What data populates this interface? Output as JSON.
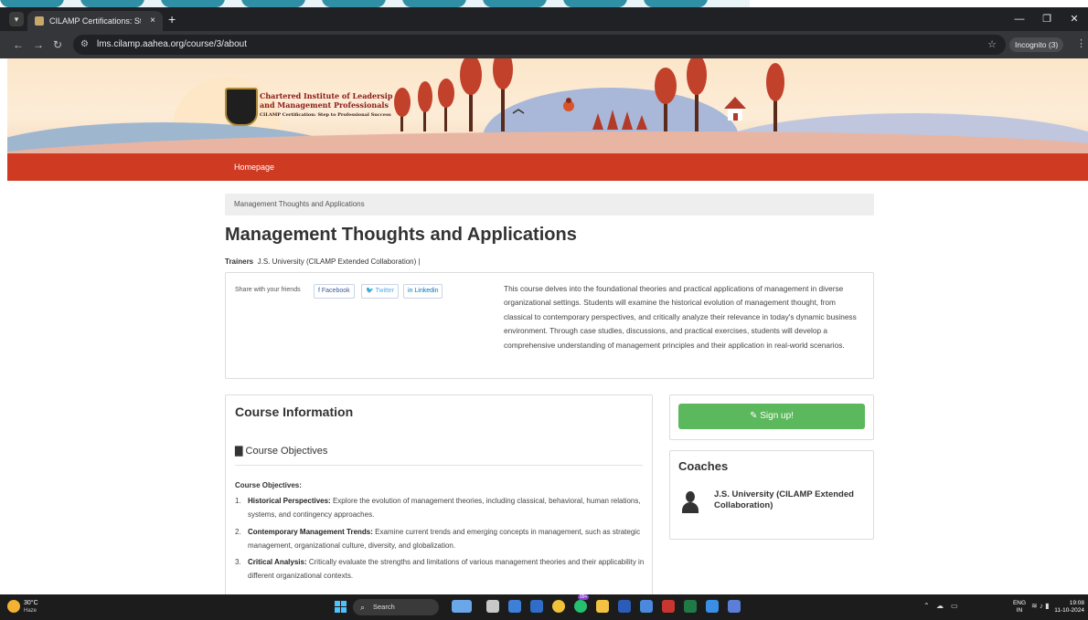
{
  "browser": {
    "tab_title": "CILAMP Certifications: Step to P",
    "tab_close": "×",
    "new_tab": "+",
    "url": "lms.cilamp.aahea.org/course/3/about",
    "incognito_label": "Incognito (3)",
    "window_controls": [
      "—",
      "❐",
      "✕"
    ],
    "nav": {
      "back": "←",
      "forward": "→",
      "reload": "↻"
    }
  },
  "banner": {
    "org_line1": "Chartered Institute of Leadersip",
    "org_line2": "and Management Professionals",
    "tagline": "CILAMP Certification: Step to Professional Success"
  },
  "nav": {
    "home": "Homepage"
  },
  "breadcrumb": "Management Thoughts and Applications",
  "course": {
    "title": "Management Thoughts and Applications",
    "trainers_label": "Trainers",
    "trainers_value": "J.S. University (CILAMP Extended Collaboration) |",
    "share_label": "Share with your friends",
    "share_buttons": [
      {
        "label": "f Facebook",
        "color": "#3b5998"
      },
      {
        "label": "🐦 Twitter",
        "color": "#55acee"
      },
      {
        "label": "in Linkedin",
        "color": "#0077b5"
      }
    ],
    "description": "This course delves into the foundational theories and practical applications of management in diverse organizational settings. Students will examine the historical evolution of management thought, from classical to contemporary perspectives, and critically analyze their relevance in today's dynamic business environment. Through case studies, discussions, and practical exercises, students will develop a comprehensive understanding of management principles and their application in real-world scenarios."
  },
  "course_info": {
    "heading": "Course Information",
    "objectives_heading": "Course Objectives",
    "objectives_sub": "Course Objectives:",
    "objectives": [
      {
        "num": "1.",
        "title": "Historical Perspectives:",
        "text": " Explore the evolution of management theories, including classical, behavioral, human relations, systems, and contingency approaches."
      },
      {
        "num": "2.",
        "title": "Contemporary Management Trends:",
        "text": " Examine current trends and emerging concepts in management, such as strategic management, organizational culture, diversity, and globalization."
      },
      {
        "num": "3.",
        "title": "Critical Analysis:",
        "text": " Critically evaluate the strengths and limitations of various management theories and their applicability in different organizational contexts."
      }
    ]
  },
  "sidebar": {
    "signup_label": "Sign up!",
    "coaches_heading": "Coaches",
    "coach_name": "J.S. University (CILAMP Extended Collaboration)"
  },
  "taskbar": {
    "temp": "30°C",
    "condition": "Haze",
    "search_label": "Search",
    "lang_top": "ENG",
    "lang_bottom": "IN",
    "time": "19:08",
    "date": "11-10-2024",
    "notif_badge": "99+"
  },
  "colors": {
    "nav_red": "#cf3a22",
    "signup_green": "#5cb85c"
  }
}
